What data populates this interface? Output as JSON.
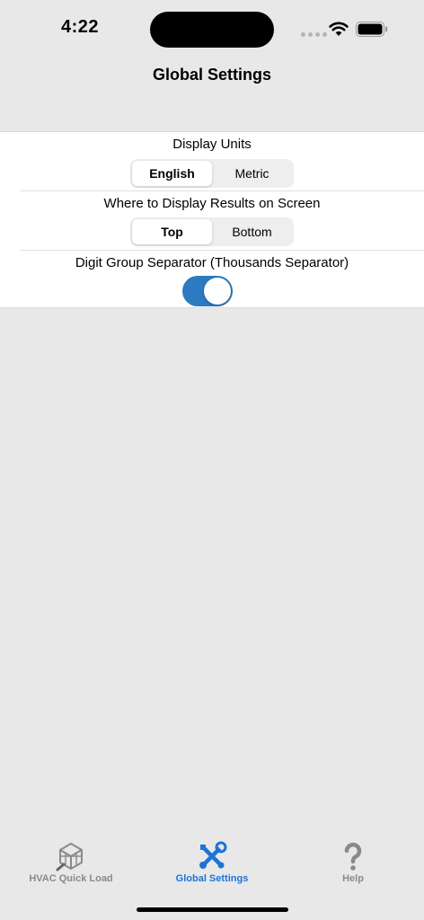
{
  "status_bar": {
    "time": "4:22"
  },
  "nav": {
    "title": "Global Settings"
  },
  "settings": {
    "display_units": {
      "label": "Display Units",
      "options": [
        "English",
        "Metric"
      ],
      "selected": "English"
    },
    "results_position": {
      "label": "Where to Display Results on Screen",
      "options": [
        "Top",
        "Bottom"
      ],
      "selected": "Top"
    },
    "digit_separator": {
      "label": "Digit Group Separator (Thousands Separator)",
      "enabled": true
    }
  },
  "tab_bar": {
    "tabs": [
      {
        "label": "HVAC Quick Load",
        "icon": "cube-icon",
        "active": false
      },
      {
        "label": "Global Settings",
        "icon": "tools-icon",
        "active": true
      },
      {
        "label": "Help",
        "icon": "question-mark-icon",
        "active": false
      }
    ]
  },
  "colors": {
    "accent": "#1e73d6",
    "toggle_on": "#2c7ac1",
    "inactive": "#8a8a8a",
    "background": "#e8e8e8"
  }
}
